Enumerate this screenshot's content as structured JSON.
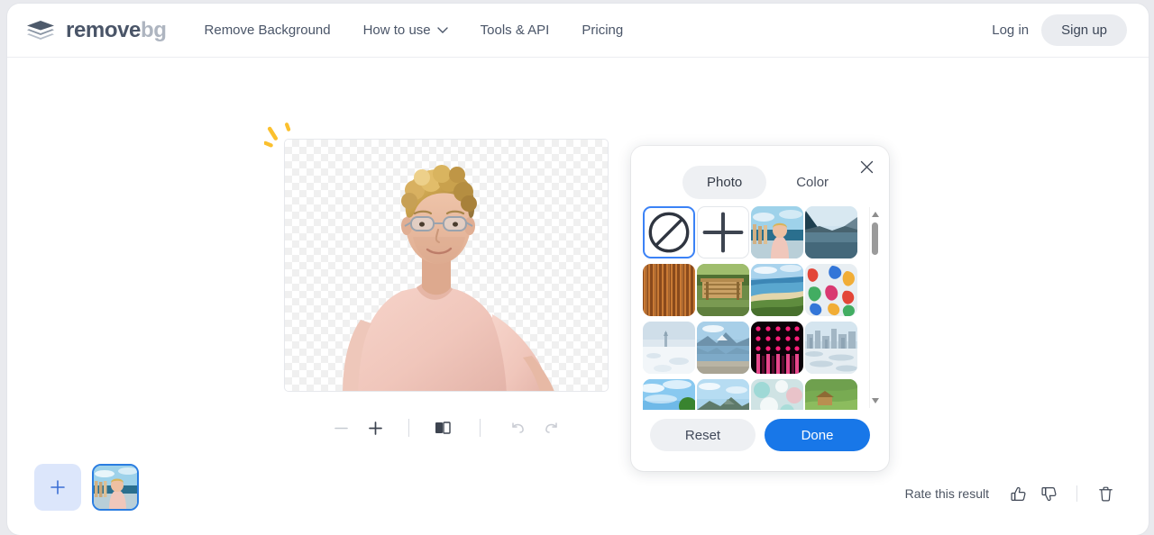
{
  "header": {
    "logo": {
      "mark": "layers-icon",
      "name": "remove",
      "suffix": "bg"
    },
    "nav": [
      {
        "label": "Remove Background",
        "icon": null
      },
      {
        "label": "How to use",
        "icon": "chevron-down-icon"
      },
      {
        "label": "Tools & API",
        "icon": null
      },
      {
        "label": "Pricing",
        "icon": null
      }
    ],
    "login_label": "Log in",
    "signup_label": "Sign up"
  },
  "editor": {
    "toolbar": [
      {
        "name": "zoom-out",
        "icon": "minus-icon",
        "disabled": true
      },
      {
        "name": "zoom-in",
        "icon": "plus-icon",
        "disabled": false
      },
      {
        "name": "compare",
        "icon": "split-compare-icon",
        "disabled": false
      },
      {
        "name": "undo",
        "icon": "undo-icon",
        "disabled": true
      },
      {
        "name": "redo",
        "icon": "redo-icon",
        "disabled": true
      }
    ],
    "canvas": {
      "background": "transparent-checkerboard",
      "subject": "man-in-pink-tshirt"
    },
    "decoration": "yellow-sparkle"
  },
  "bg_panel": {
    "close_icon": "close-icon",
    "tabs": [
      {
        "label": "Photo",
        "active": true
      },
      {
        "label": "Color",
        "active": false
      }
    ],
    "thumbnails": [
      {
        "name": "no-background",
        "icon": "circle-slash-icon",
        "selected": true,
        "type": "icon"
      },
      {
        "name": "upload-background",
        "icon": "plus-icon",
        "selected": false,
        "type": "icon"
      },
      {
        "name": "bg-portrait-dock",
        "type": "photo",
        "art": "dock"
      },
      {
        "name": "bg-lake-mountain",
        "type": "photo",
        "art": "lake"
      },
      {
        "name": "bg-wood-stripes",
        "type": "photo",
        "art": "wood"
      },
      {
        "name": "bg-cabin-forest",
        "type": "photo",
        "art": "cabin"
      },
      {
        "name": "bg-coastline",
        "type": "photo",
        "art": "coast"
      },
      {
        "name": "bg-abstract-paint",
        "type": "photo",
        "art": "paint"
      },
      {
        "name": "bg-snow-field",
        "type": "photo",
        "art": "snow"
      },
      {
        "name": "bg-mountain-lake",
        "type": "photo",
        "art": "mtnlake"
      },
      {
        "name": "bg-neon-dots",
        "type": "photo",
        "art": "neon"
      },
      {
        "name": "bg-city-waterfront",
        "type": "photo",
        "art": "city"
      },
      {
        "name": "bg-palm-sky",
        "type": "photo",
        "art": "palm"
      },
      {
        "name": "bg-volcano-lake",
        "type": "photo",
        "art": "volcano"
      },
      {
        "name": "bg-bokeh",
        "type": "photo",
        "art": "bokeh"
      },
      {
        "name": "bg-rice-terrace",
        "type": "photo",
        "art": "rice"
      }
    ],
    "scrollbar": {
      "up_icon": "caret-up-icon",
      "down_icon": "caret-down-icon"
    },
    "reset_label": "Reset",
    "done_label": "Done"
  },
  "bottom": {
    "add_label": "plus-icon",
    "thumb_name": "result-thumbnail",
    "rate_label": "Rate this result",
    "thumbs_up_icon": "thumbs-up-icon",
    "thumbs_down_icon": "thumbs-down-icon",
    "delete_icon": "trash-icon"
  },
  "colors": {
    "accent_blue": "#1877e8",
    "selected_border": "#3b82f6",
    "logo_dark": "#4a5568",
    "logo_light": "#aeb5c0",
    "sparkle_yellow": "#fbbf24"
  }
}
